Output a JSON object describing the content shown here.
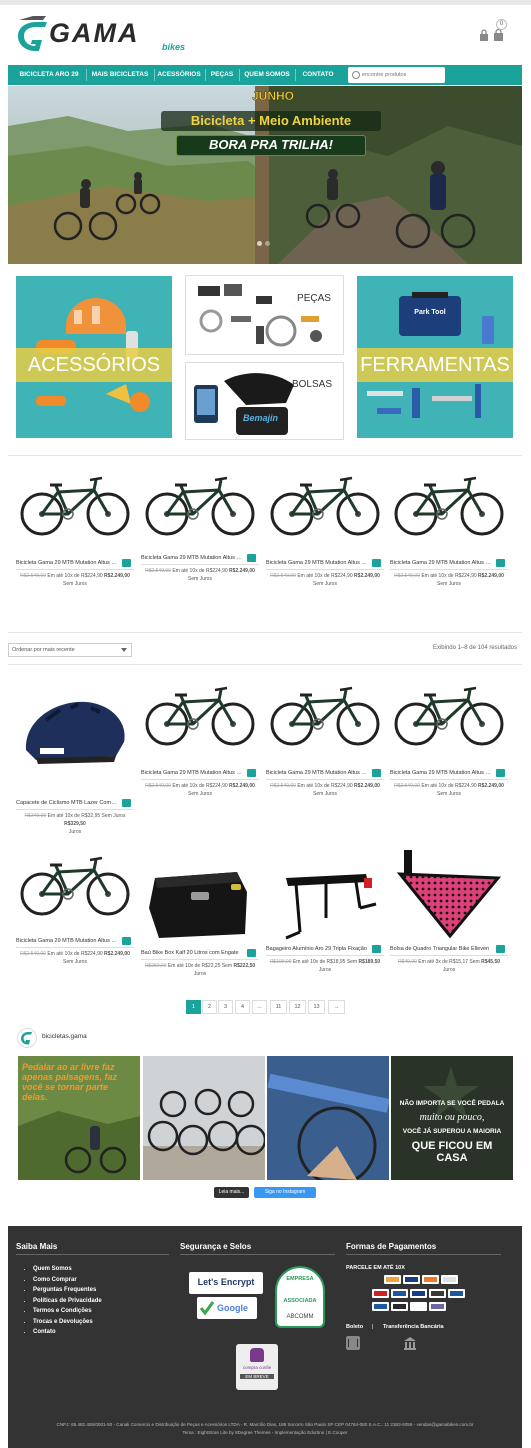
{
  "header": {
    "brand_text": "GAMA",
    "brand_sub": "bikes",
    "cart_count": "0",
    "account_icon": "lock-icon",
    "cart_icon": "bag-icon"
  },
  "nav": {
    "items": [
      "BICICLETA ARO 29",
      "MAIS BICICLETAS",
      "ACESSÓRIOS",
      "PEÇAS",
      "QUEM SOMOS",
      "CONTATO"
    ],
    "search_placeholder": "encontre produtos"
  },
  "banner": {
    "month": "JUNHO",
    "title": "Bicicleta + Meio Ambiente",
    "subtitle": "BORA PRA TRILHA!"
  },
  "categories": {
    "accessories": "ACESSÓRIOS",
    "parts": "PEÇAS",
    "bags": "BOLSAS",
    "bags_brand": "Bemajin",
    "tools": "FERRAMENTAS",
    "tools_brand": "Park Tool"
  },
  "featured": [
    {
      "name": "Bicicleta Gama 29 MTB Mutation Altus 24v",
      "old_price": "R$2.549,00",
      "installments": "Em até 10x de R$224,90",
      "price": "R$2.249,00",
      "terms": "Sem Juros"
    },
    {
      "name": "Bicicleta Gama 29 MTB Mutation Altus 24v",
      "old_price": "R$2.549,00",
      "installments": "Em até 10x de R$224,90",
      "price": "R$2.249,00",
      "terms": "Sem Juros"
    },
    {
      "name": "Bicicleta Gama 29 MTB Mutation Altus 24v",
      "old_price": "R$2.549,00",
      "installments": "Em até 10x de R$224,90",
      "price": "R$2.249,00",
      "terms": "Sem Juros"
    },
    {
      "name": "Bicicleta Gama 29 MTB Mutation Altus 24v",
      "old_price": "R$2.549,00",
      "installments": "Em até 10x de R$224,90",
      "price": "R$2.249,00",
      "terms": "Sem Juros"
    }
  ],
  "shop": {
    "sort_label": "Ordenar por mais recente",
    "results": "Exibindo 1–8 de 104 resultados"
  },
  "products": [
    {
      "name": "Capacete de Ciclismo MTB Lazer Compact",
      "old_price": "R$349,00",
      "installments": "Em até 10x de R$32,95 Sem Juros",
      "price": "R$329,50",
      "terms": "Juros",
      "type": "helmet"
    },
    {
      "name": "Bicicleta Gama 29 MTB Mutation Altus 24v",
      "old_price": "R$2.549,00",
      "installments": "Em até 10x de R$224,90",
      "price": "R$2.249,00",
      "terms": "Sem Juros",
      "type": "bike"
    },
    {
      "name": "Bicicleta Gama 29 MTB Mutation Altus 24v",
      "old_price": "R$2.549,00",
      "installments": "Em até 10x de R$224,90",
      "price": "R$2.249,00",
      "terms": "Sem Juros",
      "type": "bike"
    },
    {
      "name": "Bicicleta Gama 29 MTB Mutation Altus 24v",
      "old_price": "R$2.549,00",
      "installments": "Em até 10x de R$224,90",
      "price": "R$2.249,00",
      "terms": "Sem Juros",
      "type": "bike"
    },
    {
      "name": "Bicicleta Gama 29 MTB Mutation Altus 24v",
      "old_price": "R$2.549,00",
      "installments": "Em até 10x de R$224,90",
      "price": "R$2.249,00",
      "terms": "Sem Juros",
      "type": "bike"
    },
    {
      "name": "Baú Bike Box Kalf 20 Litros com Engate",
      "old_price": "R$250,00",
      "installments": "Em até 10x de R$22,25 Sem",
      "price": "R$222,50",
      "terms": "Juros",
      "type": "box"
    },
    {
      "name": "Bagageiro Alumínio Aro 29 Tripla Fixação",
      "old_price": "R$199,00",
      "installments": "Em até 10x de R$18,95 Sem",
      "price": "R$189,50",
      "terms": "Juros",
      "type": "rack"
    },
    {
      "name": "Bolsa de Quadro Triangular Bike Elleven",
      "old_price": "R$49,00",
      "installments": "Em até 3x de R$15,17 Sem",
      "price": "R$45,50",
      "terms": "Juros",
      "type": "bag"
    }
  ],
  "pagination": [
    "1",
    "2",
    "3",
    "4",
    "...",
    "11",
    "12",
    "13",
    "→"
  ],
  "instagram": {
    "username": "bicicletas.gama",
    "tile1_text": "Pedalar ao ar livre faz apenas paisagens, faz você se tornar parte delas.",
    "tile4_text_a": "NÃO IMPORTA SE VOCÊ PEDALA",
    "tile4_text_b": "muito ou pouco,",
    "tile4_text_c": "VOCÊ JÁ SUPEROU A MAIORIA",
    "tile4_text_d": "QUE FICOU EM CASA",
    "load_more": "Leia mais...",
    "follow": "Siga no Instagram"
  },
  "footer": {
    "col1_title": "Saiba Mais",
    "links": [
      "Quem Somos",
      "Como Comprar",
      "Perguntas Frequentes",
      "Políticas de Privacidade",
      "Termos e Condições",
      "Trocas e Devoluções",
      "Contato"
    ],
    "col2_title": "Segurança e Selos",
    "lets_encrypt": "Let's Encrypt",
    "google": "Google",
    "abcomm_top": "EMPRESA",
    "abcomm_mid": "ASSOCIADA",
    "abcomm_name": "ABCOMM",
    "compra_label": "compra confie",
    "compra_status": "EM BREVE",
    "col3_title": "Formas de Pagamentos",
    "installments": "PARCELE EM ATÉ 10X",
    "boleto": "Boleto",
    "separator": "|",
    "transfer": "Transferência Bancária",
    "copyright": "CNPJ: 65.482.455/0001-50 - Canali Comercio e Distribuição de Peças e Acessórios LTDA - R. Marcílio Dias, 188 Socorro São Paulo SP CEP 04764-080 S.A.C.: 11 2363-6056 - vendas@gamabikes.com.br",
    "credits": "Tema : EightStore Lite by 8Degree Themes - Implementação Edurtino | E.Cooper"
  },
  "colors": {
    "teal": "#1aa39a",
    "footer_bg": "#333333",
    "banner_yellow": "#f2d33c"
  }
}
